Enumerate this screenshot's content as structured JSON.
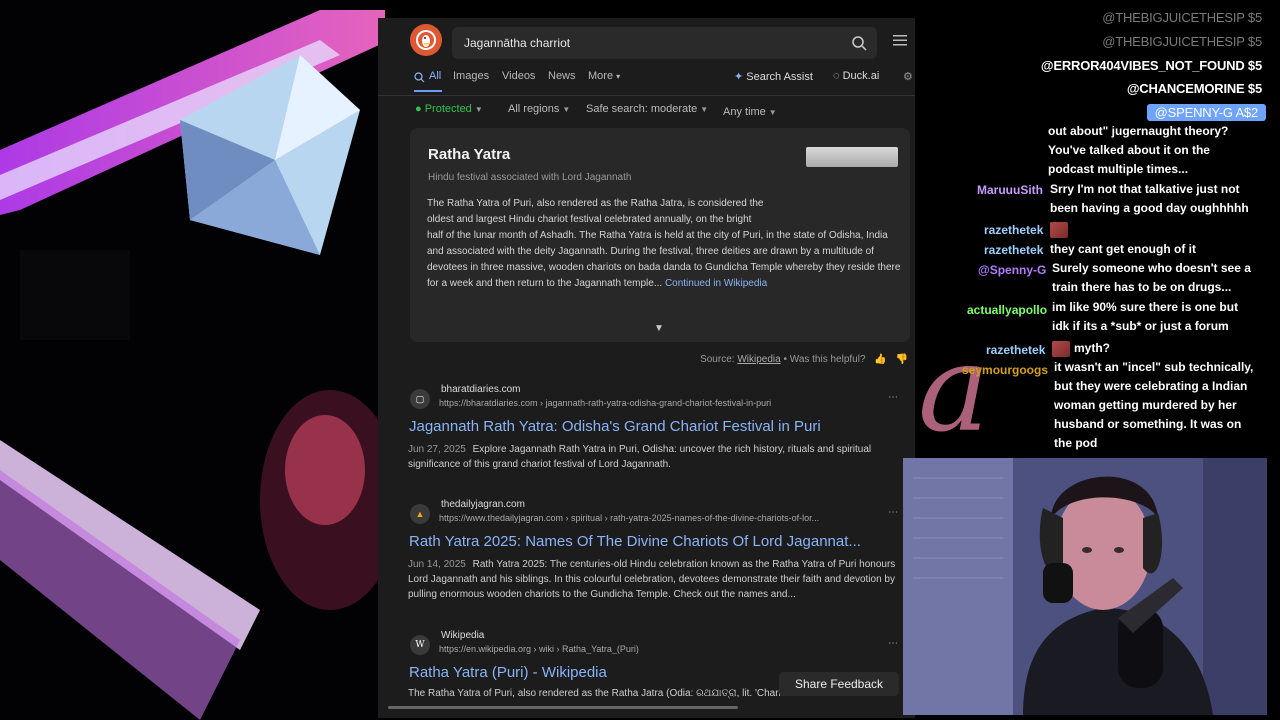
{
  "search": {
    "query": "Jagannātha charriot"
  },
  "tabs": [
    {
      "label": "All"
    },
    {
      "label": "Images"
    },
    {
      "label": "Videos"
    },
    {
      "label": "News"
    },
    {
      "label": "More"
    }
  ],
  "assist": {
    "search_assist": "Search Assist",
    "duck_ai": "Duck.ai"
  },
  "filters": {
    "protected": "Protected",
    "regions": "All regions",
    "safe_search": "Safe search: moderate",
    "time": "Any time"
  },
  "knowledge_panel": {
    "title": "Ratha Yatra",
    "subtitle": "Hindu festival associated with Lord Jagannath",
    "lead": "The Ratha Yatra of Puri, also rendered as the Ratha Jatra, is considered the oldest and largest Hindu chariot festival celebrated annually, on the bright",
    "body": "half of the lunar month of Ashadh. The Ratha Yatra is held at the city of Puri, in the state of Odisha, India and associated with the deity Jagannath. During the festival, three deities are drawn by a multitude of devotees in three massive, wooden chariots on bada danda to Gundicha Temple whereby they reside there for a week and then return to the Jagannath temple...",
    "more": "Continued in Wikipedia"
  },
  "source": {
    "prefix": "Source:",
    "name": "Wikipedia",
    "helpful": "• Was this helpful?"
  },
  "results": [
    {
      "site": "bharatdiaries.com",
      "url": "https://bharatdiaries.com › jagannath-rath-yatra-odisha-grand-chariot-festival-in-puri",
      "title": "Jagannath Rath Yatra: Odisha's Grand Chariot Festival in Puri",
      "date": "Jun 27, 2025",
      "snippet": "Explore Jagannath Rath Yatra in Puri, Odisha: uncover the rich history, rituals and spiritual significance of this grand chariot festival of Lord Jagannath."
    },
    {
      "site": "thedailyjagran.com",
      "url": "https://www.thedailyjagran.com › spiritual › rath-yatra-2025-names-of-the-divine-chariots-of-lor...",
      "title": "Rath Yatra 2025: Names Of The Divine Chariots Of Lord Jagannat...",
      "date": "Jun 14, 2025",
      "snippet": "Rath Yatra 2025: The centuries-old Hindu celebration known as the Ratha Yatra of Puri honours Lord Jagannath and his siblings. In this colourful celebration, devotees demonstrate their faith and devotion by pulling enormous wooden chariots to the Gundicha Temple. Check out the names and..."
    },
    {
      "site": "Wikipedia",
      "url": "https://en.wikipedia.org › wiki › Ratha_Yatra_(Puri)",
      "title": "Ratha Yatra (Puri) - Wikipedia",
      "date": "",
      "snippet": "The Ratha Yatra of Puri, also rendered as the Ratha Jatra (Odia: ରଥଯାତ୍ରା, lit. 'Chariot Festival' or 'Car"
    }
  ],
  "feedback": "Share Feedback",
  "donations": [
    "@THEBIGJUICETHESIP  $5",
    "@THEBIGJUICETHESIP  $5",
    "@ERROR404VIBES_NOT_FOUND  $5",
    "@CHANCEMORINE  $5",
    "@SPENNY-G  A$2"
  ],
  "chat": {
    "m0": "out about\" jugernaught theory?",
    "m0b": "You've talked about it on the",
    "m0c": "podcast multiple times...",
    "n1": "MaruuuSith",
    "m1": "Srry I'm not that talkative just not",
    "m1b": "been having a good day oughhhhh",
    "n2": "razethetek",
    "n3": "razethetek",
    "m3": "they cant get enough of it",
    "n4": "@Spenny-G",
    "m4": "Surely someone who doesn't see a",
    "m4b": "train there has to be on drugs...",
    "n5": "actuallyapollo",
    "m5": "im like 90% sure there is one but",
    "m5b": "idk if its a *sub* or just a forum",
    "m5c": "myth?",
    "n6": "razethetek",
    "n7": "seymourgoogs",
    "m7": "it wasn't an \"incel\" sub technically,",
    "m7b": "but they were celebrating a Indian",
    "m7c": "woman getting murdered by her",
    "m7d": "husband or something. It was on",
    "m7e": "the pod"
  },
  "colors": {
    "link": "#8ab4f8",
    "ddg_orange": "#de5833",
    "protected_green": "#32c24d",
    "donation_highlight": "#6ea3ff"
  }
}
